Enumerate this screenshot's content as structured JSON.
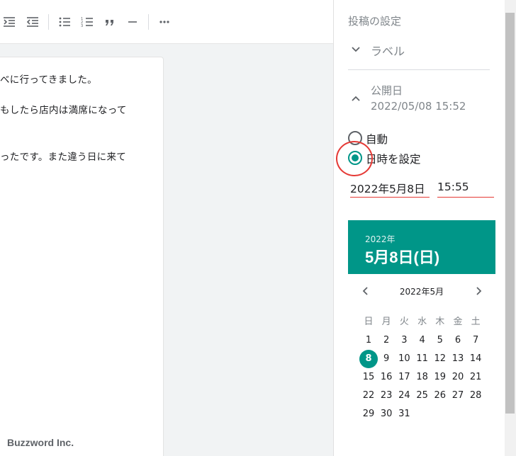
{
  "editor": {
    "toolbar": {
      "icons": [
        "indent-icon",
        "outdent-icon",
        "bulleted-list-icon",
        "numbered-list-icon",
        "quote-icon",
        "horizontal-rule-icon",
        "more-icon"
      ]
    },
    "body_lines": [
      "べに行ってきました。",
      "もしたら店内は満席になって",
      "ったです。また違う日に来て"
    ]
  },
  "watermark": "Buzzword Inc.",
  "settings": {
    "title": "投稿の設定",
    "labels_section": "ラベル",
    "publish": {
      "title": "公開日",
      "value": "2022/05/08 15:52",
      "options": [
        {
          "label": "自動",
          "checked": false
        },
        {
          "label": "日時を設定",
          "checked": true
        }
      ],
      "date_field": "2022年5月8日",
      "time_field": "15:55"
    },
    "calendar": {
      "header_year": "2022年",
      "header_date": "5月8日(日)",
      "month_label": "2022年5月",
      "weekdays": [
        "日",
        "月",
        "火",
        "水",
        "木",
        "金",
        "土"
      ],
      "weeks": [
        [
          "1",
          "2",
          "3",
          "4",
          "5",
          "6",
          "7"
        ],
        [
          "8",
          "9",
          "10",
          "11",
          "12",
          "13",
          "14"
        ],
        [
          "15",
          "16",
          "17",
          "18",
          "19",
          "20",
          "21"
        ],
        [
          "22",
          "23",
          "24",
          "25",
          "26",
          "27",
          "28"
        ],
        [
          "29",
          "30",
          "31",
          "",
          "",
          "",
          ""
        ]
      ],
      "selected": "8",
      "accent_color": "#009688"
    }
  },
  "colors": {
    "accent": "#009688",
    "highlight": "#e53935"
  }
}
